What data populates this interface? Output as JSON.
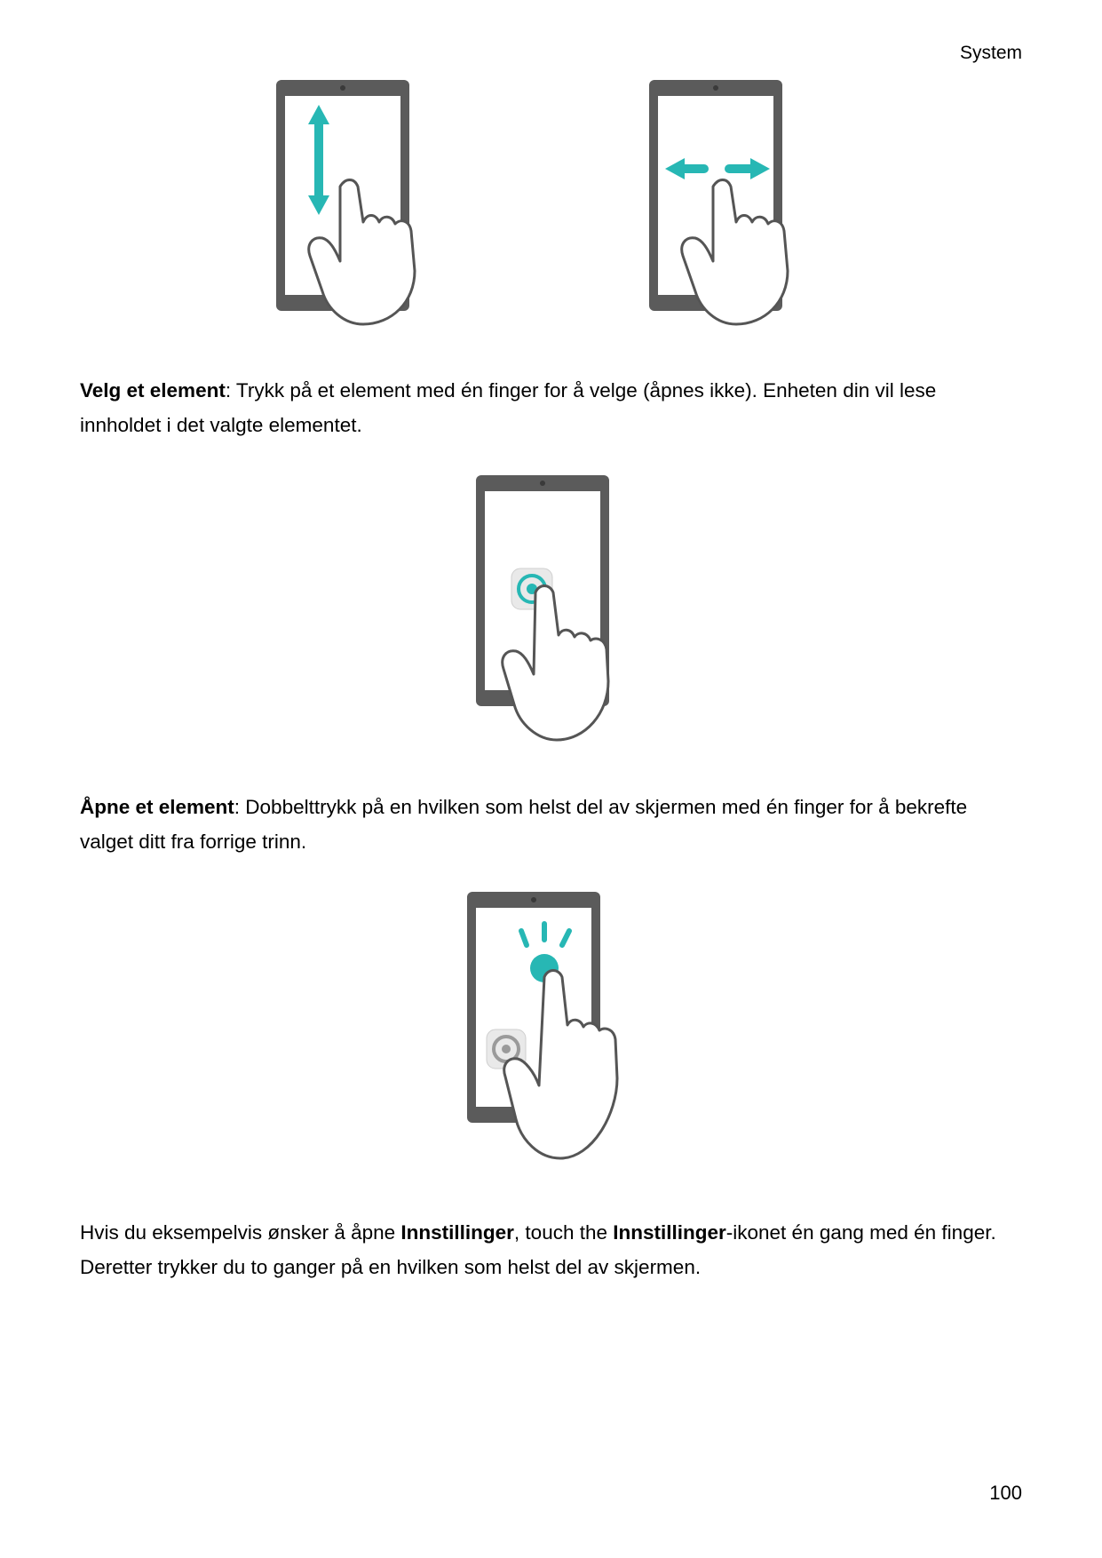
{
  "header": {
    "section": "System"
  },
  "paragraphs": {
    "p1": {
      "bold": "Velg et element",
      "rest": ": Trykk på et element med én finger for å velge (åpnes ikke). Enheten din vil lese innholdet i det valgte elementet."
    },
    "p2": {
      "bold": "Åpne et element",
      "rest": ": Dobbelttrykk på en hvilken som helst del av skjermen med én finger for å bekrefte valget ditt fra forrige trinn."
    },
    "p3": {
      "pre": "Hvis du eksempelvis ønsker å åpne ",
      "bold1": "Innstillinger",
      "mid": ", touch the ",
      "bold2": "Innstillinger",
      "post": "-ikonet én gang med én finger. Deretter trykker du to ganger på en hvilken som helst del av skjermen."
    }
  },
  "footer": {
    "page_number": "100"
  },
  "colors": {
    "accent": "#27b7b4",
    "device": "#5b5b5b",
    "line": "#555555"
  }
}
